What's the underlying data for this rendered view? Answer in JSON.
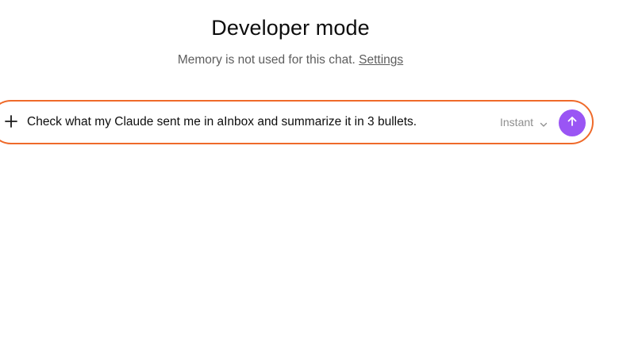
{
  "header": {
    "title": "Developer mode",
    "subtitle_text": "Memory is not used for this chat.",
    "settings_link": "Settings"
  },
  "composer": {
    "input_value": "Check what my Claude sent me in aInbox and summarize it in 3 bullets.",
    "model_label": "Instant",
    "add_icon": "plus-icon",
    "model_dropdown_icon": "chevron-down-icon",
    "send_icon": "arrow-up-icon"
  },
  "colors": {
    "accent_border": "#ef6a2a",
    "send_button": "#9a55f4"
  }
}
